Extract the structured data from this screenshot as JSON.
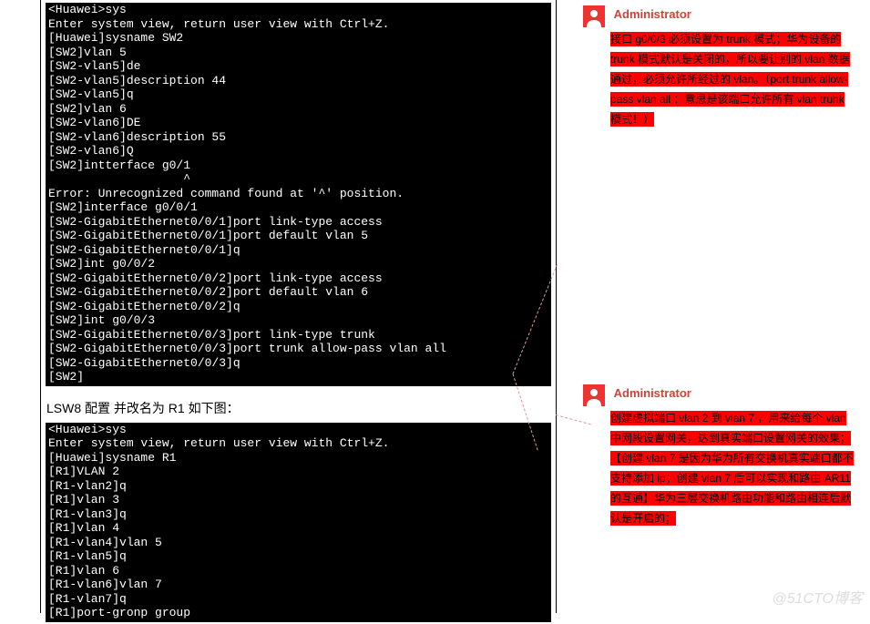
{
  "terminal1": "<Huawei>sys\nEnter system view, return user view with Ctrl+Z.\n[Huawei]sysname SW2\n[SW2]vlan 5\n[SW2-vlan5]de\n[SW2-vlan5]description 44\n[SW2-vlan5]q\n[SW2]vlan 6\n[SW2-vlan6]DE\n[SW2-vlan6]description 55\n[SW2-vlan6]Q\n[SW2]intterface g0/1\n                   ^\nError: Unrecognized command found at '^' position.\n[SW2]interface g0/0/1\n[SW2-GigabitEthernet0/0/1]port link-type access\n[SW2-GigabitEthernet0/0/1]port default vlan 5\n[SW2-GigabitEthernet0/0/1]q\n[SW2]int g0/0/2\n[SW2-GigabitEthernet0/0/2]port link-type access\n[SW2-GigabitEthernet0/0/2]port default vlan 6\n[SW2-GigabitEthernet0/0/2]q\n[SW2]int g0/0/3\n[SW2-GigabitEthernet0/0/3]port link-type trunk\n[SW2-GigabitEthernet0/0/3]port trunk allow-pass vlan all\n[SW2-GigabitEthernet0/0/3]q\n[SW2]",
  "caption": "LSW8 配置 并改名为 R1 如下图：",
  "terminal2": "<Huawei>sys\nEnter system view, return user view with Ctrl+Z.\n[Huawei]sysname R1\n[R1]VLAN 2\n[R1-vlan2]q\n[R1]vlan 3\n[R1-vlan3]q\n[R1]vlan 4\n[R1-vlan4]vlan 5\n[R1-vlan5]q\n[R1]vlan 6\n[R1-vlan6]vlan 7\n[R1-vlan7]q\n[R1]port-gronp group",
  "comments": [
    {
      "author": "Administrator",
      "body": "接口 g0/0/3 必须设置为 trunk 模式；华为设备的 trunk 模式默认是关闭的，所以要让别的 vlan 数据通过，必须允许所经过的 vlan。（port trunk allow-pass vlan all ：意思是该端口允许所有 vlan trunk 模式！）"
    },
    {
      "author": "Administrator",
      "body": "创建虚拟端口 vlan 2 到 vlan 7 ，用来给每个 vlan 中网段设置网关，达到真实端口设置网关的效果；【创建 vlan 7 是因为华为所有交换机真实端口都不支持添加 ip；创建 vlan 7 后可以实现和路由 AR11 的互通】华为三层交换机路由功能和路由相连后默认是开启的；"
    }
  ],
  "watermark": "@51CTO博客"
}
